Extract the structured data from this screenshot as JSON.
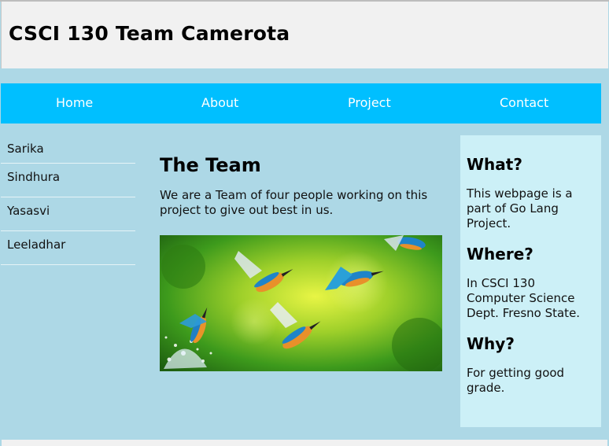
{
  "header": {
    "title": "CSCI 130 Team Camerota"
  },
  "nav": {
    "items": [
      {
        "label": "Home"
      },
      {
        "label": "About"
      },
      {
        "label": "Project"
      },
      {
        "label": "Contact"
      }
    ]
  },
  "sidebar": {
    "items": [
      {
        "label": "Sarika"
      },
      {
        "label": "Sindhura"
      },
      {
        "label": "Yasasvi"
      },
      {
        "label": "Leeladhar"
      }
    ]
  },
  "main": {
    "heading": "The Team",
    "text": "We are a Team of four people working on this project to give out best in us."
  },
  "aside": {
    "sections": [
      {
        "heading": "What?",
        "text": "This webpage is a part of Go Lang Project."
      },
      {
        "heading": "Where?",
        "text": "In CSCI 130 Computer Science Dept. Fresno State."
      },
      {
        "heading": "Why?",
        "text": "For getting good grade."
      }
    ]
  },
  "colors": {
    "background": "#add8e6",
    "header": "#f1f1f1",
    "navbar": "#00bfff",
    "aside": "#ccf0f7"
  }
}
